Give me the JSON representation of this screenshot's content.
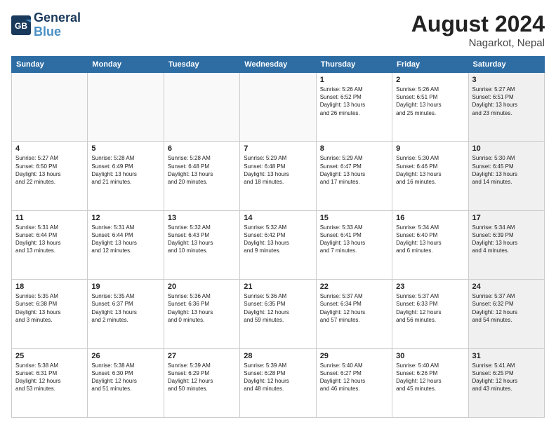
{
  "header": {
    "logo_line1": "General",
    "logo_line2": "Blue",
    "month_title": "August 2024",
    "location": "Nagarkot, Nepal"
  },
  "days_of_week": [
    "Sunday",
    "Monday",
    "Tuesday",
    "Wednesday",
    "Thursday",
    "Friday",
    "Saturday"
  ],
  "weeks": [
    [
      {
        "day": "",
        "info": "",
        "shaded": false
      },
      {
        "day": "",
        "info": "",
        "shaded": false
      },
      {
        "day": "",
        "info": "",
        "shaded": false
      },
      {
        "day": "",
        "info": "",
        "shaded": false
      },
      {
        "day": "1",
        "info": "Sunrise: 5:26 AM\nSunset: 6:52 PM\nDaylight: 13 hours\nand 26 minutes.",
        "shaded": false
      },
      {
        "day": "2",
        "info": "Sunrise: 5:26 AM\nSunset: 6:51 PM\nDaylight: 13 hours\nand 25 minutes.",
        "shaded": false
      },
      {
        "day": "3",
        "info": "Sunrise: 5:27 AM\nSunset: 6:51 PM\nDaylight: 13 hours\nand 23 minutes.",
        "shaded": true
      }
    ],
    [
      {
        "day": "4",
        "info": "Sunrise: 5:27 AM\nSunset: 6:50 PM\nDaylight: 13 hours\nand 22 minutes.",
        "shaded": false
      },
      {
        "day": "5",
        "info": "Sunrise: 5:28 AM\nSunset: 6:49 PM\nDaylight: 13 hours\nand 21 minutes.",
        "shaded": false
      },
      {
        "day": "6",
        "info": "Sunrise: 5:28 AM\nSunset: 6:48 PM\nDaylight: 13 hours\nand 20 minutes.",
        "shaded": false
      },
      {
        "day": "7",
        "info": "Sunrise: 5:29 AM\nSunset: 6:48 PM\nDaylight: 13 hours\nand 18 minutes.",
        "shaded": false
      },
      {
        "day": "8",
        "info": "Sunrise: 5:29 AM\nSunset: 6:47 PM\nDaylight: 13 hours\nand 17 minutes.",
        "shaded": false
      },
      {
        "day": "9",
        "info": "Sunrise: 5:30 AM\nSunset: 6:46 PM\nDaylight: 13 hours\nand 16 minutes.",
        "shaded": false
      },
      {
        "day": "10",
        "info": "Sunrise: 5:30 AM\nSunset: 6:45 PM\nDaylight: 13 hours\nand 14 minutes.",
        "shaded": true
      }
    ],
    [
      {
        "day": "11",
        "info": "Sunrise: 5:31 AM\nSunset: 6:44 PM\nDaylight: 13 hours\nand 13 minutes.",
        "shaded": false
      },
      {
        "day": "12",
        "info": "Sunrise: 5:31 AM\nSunset: 6:44 PM\nDaylight: 13 hours\nand 12 minutes.",
        "shaded": false
      },
      {
        "day": "13",
        "info": "Sunrise: 5:32 AM\nSunset: 6:43 PM\nDaylight: 13 hours\nand 10 minutes.",
        "shaded": false
      },
      {
        "day": "14",
        "info": "Sunrise: 5:32 AM\nSunset: 6:42 PM\nDaylight: 13 hours\nand 9 minutes.",
        "shaded": false
      },
      {
        "day": "15",
        "info": "Sunrise: 5:33 AM\nSunset: 6:41 PM\nDaylight: 13 hours\nand 7 minutes.",
        "shaded": false
      },
      {
        "day": "16",
        "info": "Sunrise: 5:34 AM\nSunset: 6:40 PM\nDaylight: 13 hours\nand 6 minutes.",
        "shaded": false
      },
      {
        "day": "17",
        "info": "Sunrise: 5:34 AM\nSunset: 6:39 PM\nDaylight: 13 hours\nand 4 minutes.",
        "shaded": true
      }
    ],
    [
      {
        "day": "18",
        "info": "Sunrise: 5:35 AM\nSunset: 6:38 PM\nDaylight: 13 hours\nand 3 minutes.",
        "shaded": false
      },
      {
        "day": "19",
        "info": "Sunrise: 5:35 AM\nSunset: 6:37 PM\nDaylight: 13 hours\nand 2 minutes.",
        "shaded": false
      },
      {
        "day": "20",
        "info": "Sunrise: 5:36 AM\nSunset: 6:36 PM\nDaylight: 13 hours\nand 0 minutes.",
        "shaded": false
      },
      {
        "day": "21",
        "info": "Sunrise: 5:36 AM\nSunset: 6:35 PM\nDaylight: 12 hours\nand 59 minutes.",
        "shaded": false
      },
      {
        "day": "22",
        "info": "Sunrise: 5:37 AM\nSunset: 6:34 PM\nDaylight: 12 hours\nand 57 minutes.",
        "shaded": false
      },
      {
        "day": "23",
        "info": "Sunrise: 5:37 AM\nSunset: 6:33 PM\nDaylight: 12 hours\nand 56 minutes.",
        "shaded": false
      },
      {
        "day": "24",
        "info": "Sunrise: 5:37 AM\nSunset: 6:32 PM\nDaylight: 12 hours\nand 54 minutes.",
        "shaded": true
      }
    ],
    [
      {
        "day": "25",
        "info": "Sunrise: 5:38 AM\nSunset: 6:31 PM\nDaylight: 12 hours\nand 53 minutes.",
        "shaded": false
      },
      {
        "day": "26",
        "info": "Sunrise: 5:38 AM\nSunset: 6:30 PM\nDaylight: 12 hours\nand 51 minutes.",
        "shaded": false
      },
      {
        "day": "27",
        "info": "Sunrise: 5:39 AM\nSunset: 6:29 PM\nDaylight: 12 hours\nand 50 minutes.",
        "shaded": false
      },
      {
        "day": "28",
        "info": "Sunrise: 5:39 AM\nSunset: 6:28 PM\nDaylight: 12 hours\nand 48 minutes.",
        "shaded": false
      },
      {
        "day": "29",
        "info": "Sunrise: 5:40 AM\nSunset: 6:27 PM\nDaylight: 12 hours\nand 46 minutes.",
        "shaded": false
      },
      {
        "day": "30",
        "info": "Sunrise: 5:40 AM\nSunset: 6:26 PM\nDaylight: 12 hours\nand 45 minutes.",
        "shaded": false
      },
      {
        "day": "31",
        "info": "Sunrise: 5:41 AM\nSunset: 6:25 PM\nDaylight: 12 hours\nand 43 minutes.",
        "shaded": true
      }
    ]
  ]
}
